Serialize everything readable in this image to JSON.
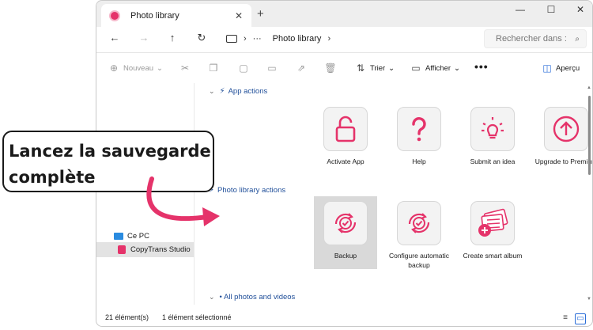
{
  "window": {
    "tab_title": "Photo library",
    "tab_close": "✕",
    "new_tab": "+",
    "minimize": "—",
    "maximize": "☐",
    "close": "✕"
  },
  "nav": {
    "back": "←",
    "forward": "→",
    "up": "↑",
    "refresh": "↻",
    "path_sep1": "›",
    "path_more": "···",
    "path_item": "Photo library",
    "path_sep2": "›",
    "search_placeholder": "Rechercher dans :",
    "search_icon": "⌕"
  },
  "toolbar": {
    "new_label": "Nouveau",
    "sort_label": "Trier",
    "view_label": "Afficher",
    "more": "•••",
    "preview_label": "Aperçu",
    "dropdown": "⌄"
  },
  "sidebar": {
    "items": [
      {
        "label": "Ce PC",
        "icon": "computer-icon"
      },
      {
        "label": "CopyTrans Studio",
        "icon": "copytrans-icon",
        "selected": true
      }
    ]
  },
  "groups": {
    "app_actions": {
      "chevron": "⌄",
      "bolt": "⚡",
      "title": "App actions",
      "items": [
        {
          "label": "Activate App",
          "icon": "unlock-icon"
        },
        {
          "label": "Help",
          "icon": "question-icon"
        },
        {
          "label": "Submit an idea",
          "icon": "lightbulb-icon"
        },
        {
          "label": "Upgrade to Premium",
          "icon": "upgrade-arrow-icon"
        }
      ]
    },
    "library_actions": {
      "bolt": "⚡",
      "title": "Photo library actions",
      "items": [
        {
          "label": "Backup",
          "icon": "backup-icon",
          "selected": true
        },
        {
          "label": "Configure automatic backup",
          "icon": "auto-backup-icon"
        },
        {
          "label": "Create smart album",
          "icon": "smart-album-icon"
        }
      ]
    },
    "all_photos": {
      "chevron": "⌄",
      "title": "• All photos and videos"
    }
  },
  "status": {
    "count": "21 élément(s)",
    "selected": "1 élément sélectionné"
  },
  "callout": {
    "line1": "Lancez la sauvegarde",
    "line2": "complète"
  },
  "colors": {
    "accent": "#e5336a",
    "link_blue": "#1f4e99",
    "selection": "#d9d9d9"
  }
}
